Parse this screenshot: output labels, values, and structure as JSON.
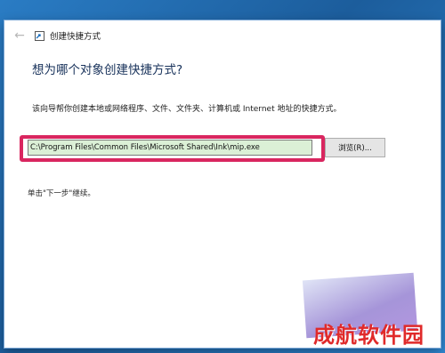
{
  "window": {
    "title": "创建快捷方式",
    "back_icon": "back-arrow-icon"
  },
  "content": {
    "heading": "想为哪个对象创建快捷方式?",
    "description": "该向导帮你创建本地或网络程序、文件、文件夹、计算机或 Internet 地址的快捷方式。",
    "location_label": "请键入对象的位置(T):",
    "location_value": "C:\\Program Files\\Common Files\\Microsoft Shared\\Ink\\mip.exe",
    "browse_label": "浏览(R)...",
    "instruction": "单击\"下一步\"继续。"
  },
  "colors": {
    "highlight": "#d9265f",
    "input_background": "#dbf0d6",
    "desktop": "#1e6fb5"
  },
  "watermark": {
    "text": "成航软件园"
  }
}
